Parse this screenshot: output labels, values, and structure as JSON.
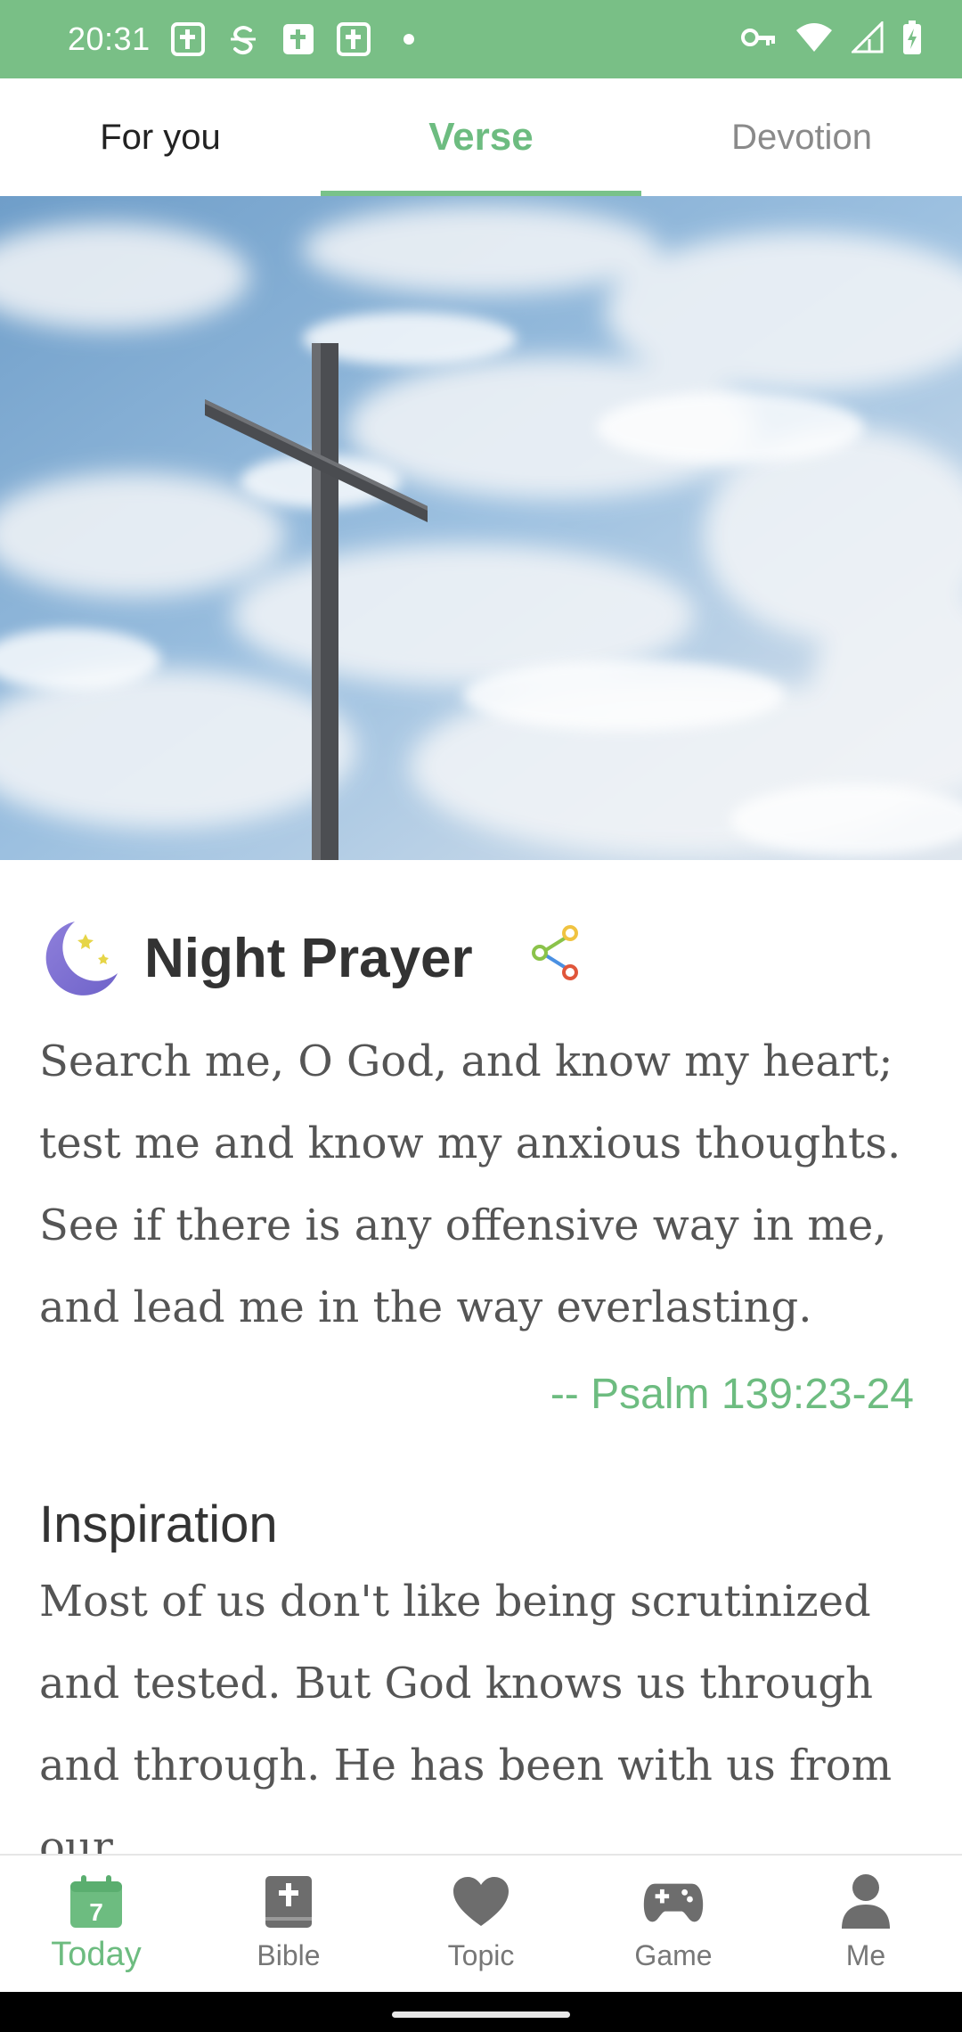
{
  "status_bar": {
    "time": "20:31",
    "notification_icons": [
      "bible-notification-icon",
      "s-app-icon",
      "bible-notification-icon",
      "bible-notification-icon",
      "dot-icon"
    ],
    "system_icons": [
      "key-icon",
      "wifi-icon",
      "signal-icon",
      "battery-icon"
    ],
    "background_color": "#79bf86"
  },
  "tabs": [
    {
      "label": "For you",
      "active": false
    },
    {
      "label": "Verse",
      "active": true
    },
    {
      "label": "Devotion",
      "active": false
    }
  ],
  "hero": {
    "icon": "cross-image"
  },
  "prayer": {
    "title": "Night Prayer",
    "icon": "moon-icon",
    "share_icon": "share-icon",
    "verse": "Search me, O God, and know my heart; test me and know my anxious thoughts. See if there is any offensive way in me, and lead me in the way everlasting.",
    "reference": "-- Psalm 139:23-24"
  },
  "inspiration": {
    "title": "Inspiration",
    "text": "Most of us don't like being scrutinized and tested. But God knows us through and through. He has been with us from our"
  },
  "bottom_nav": [
    {
      "label": "Today",
      "icon": "calendar-icon",
      "badge": "7",
      "active": true
    },
    {
      "label": "Bible",
      "icon": "bible-icon",
      "active": false
    },
    {
      "label": "Topic",
      "icon": "heart-icon",
      "active": false
    },
    {
      "label": "Game",
      "icon": "gamepad-icon",
      "active": false
    },
    {
      "label": "Me",
      "icon": "person-icon",
      "active": false
    }
  ],
  "colors": {
    "accent": "#6dbc80",
    "text_dark": "#333333",
    "text_body": "#555555",
    "inactive": "#777777"
  }
}
